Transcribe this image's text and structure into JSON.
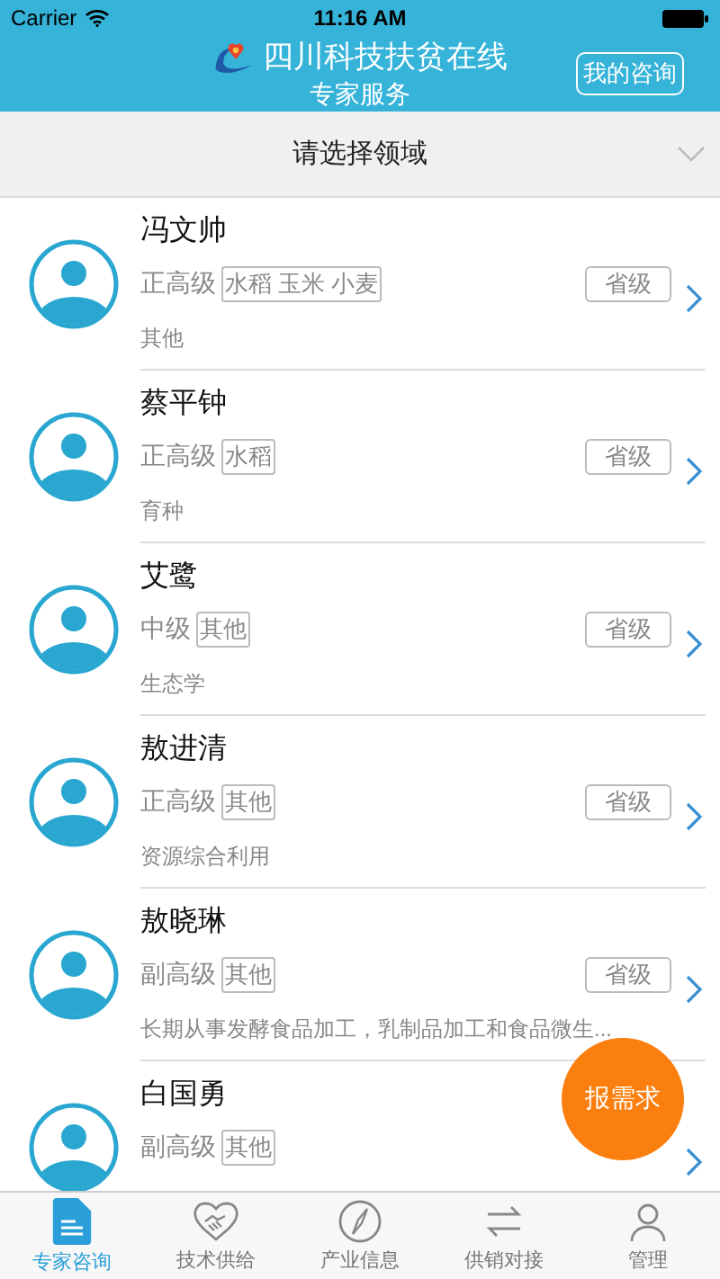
{
  "status_bar": {
    "carrier": "Carrier",
    "time": "11:16 AM"
  },
  "header": {
    "title": "四川科技扶贫在线",
    "subtitle": "专家服务",
    "action": "我的咨询"
  },
  "filter": {
    "label": "请选择领域"
  },
  "experts": [
    {
      "name": "冯文帅",
      "rank": "正高级",
      "field": "水稻 玉米 小麦",
      "region": "省级",
      "description": "其他"
    },
    {
      "name": "蔡平钟",
      "rank": "正高级",
      "field": "水稻",
      "region": "省级",
      "description": "育种"
    },
    {
      "name": "艾鹭",
      "rank": "中级",
      "field": "其他",
      "region": "省级",
      "description": "生态学"
    },
    {
      "name": "敖进清",
      "rank": "正高级",
      "field": "其他",
      "region": "省级",
      "description": "资源综合利用"
    },
    {
      "name": "敖晓琳",
      "rank": "副高级",
      "field": "其他",
      "region": "省级",
      "description": "长期从事发酵食品加工，乳制品加工和食品微生..."
    },
    {
      "name": "白国勇",
      "rank": "副高级",
      "field": "其他"
    }
  ],
  "fab": {
    "label": "报需求"
  },
  "tabs": [
    {
      "label": "专家咨询",
      "kind": "document",
      "selected": true
    },
    {
      "label": "技术供给",
      "kind": "handshake",
      "selected": false
    },
    {
      "label": "产业信息",
      "kind": "compass",
      "selected": false
    },
    {
      "label": "供销对接",
      "kind": "exchange",
      "selected": false
    },
    {
      "label": "管理",
      "kind": "person",
      "selected": false
    }
  ]
}
